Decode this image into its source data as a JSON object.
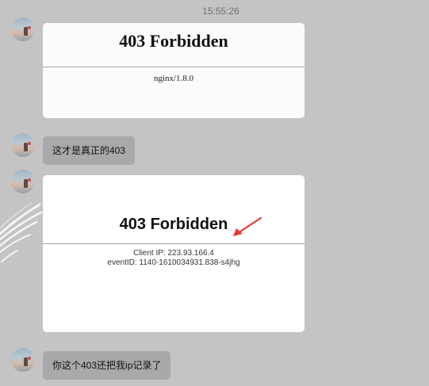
{
  "chat": {
    "timestamp": "15:55:26",
    "messages": [
      {
        "type": "image",
        "heading": "403 Forbidden",
        "server": "nginx/1.8.0"
      },
      {
        "type": "text",
        "text": "这才是真正的403"
      },
      {
        "type": "image",
        "heading": "403 Forbidden",
        "client_ip": "Client IP: 223.93.166.4",
        "event_id": "eventID: 1140-1610034931.838-s4jhg"
      },
      {
        "type": "text",
        "text": "你这个403还把我ip记录了"
      }
    ]
  },
  "colors": {
    "background": "#c4c4c4",
    "bubble": "#a9a9a9",
    "card": "#ffffff",
    "arrow": "#e8382f"
  },
  "icons": {
    "avatar": "avatar-icon",
    "annotation": "red-arrow-icon"
  }
}
